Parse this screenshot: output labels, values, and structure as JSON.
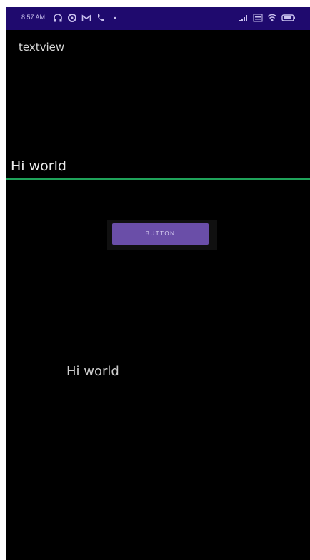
{
  "status_bar": {
    "time": "8:57 AM",
    "left_icons": [
      "headphones-icon",
      "sync-icon",
      "gmail-icon",
      "phone-icon",
      "dot-icon"
    ],
    "right_icons": [
      "signal-icon",
      "volte-icon",
      "wifi-icon",
      "battery-icon"
    ],
    "background_color": "#1f0a6e"
  },
  "content": {
    "top_textview": "textview",
    "edit_text_value": "Hi world",
    "edit_text_underline_color": "#1fa35a",
    "button_label": "BUTTON",
    "button_color": "#6a4ea8",
    "bottom_textview": "Hi world"
  }
}
